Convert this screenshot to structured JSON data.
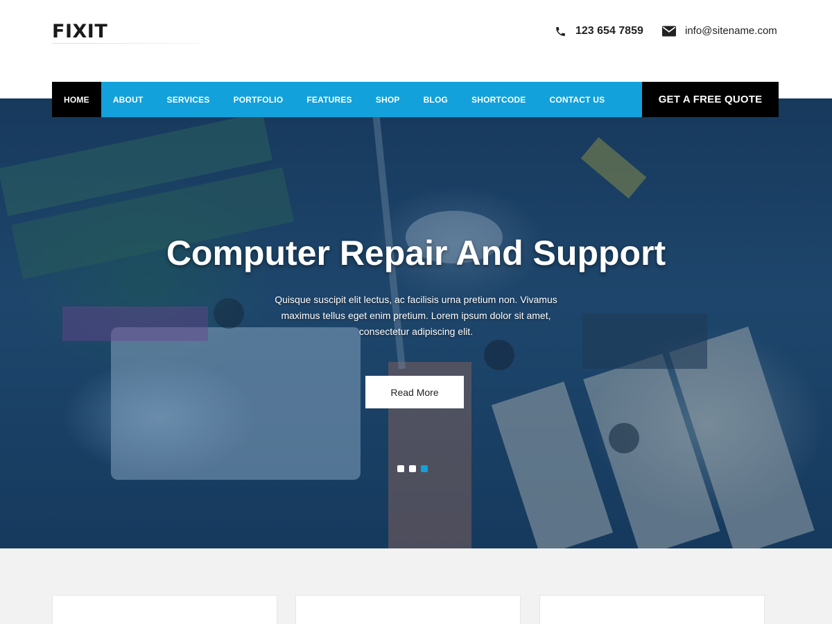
{
  "header": {
    "logo": "FIXIT",
    "phone": "123 654 7859",
    "email": "info@sitename.com",
    "phone_icon": "phone-icon",
    "email_icon": "envelope-icon"
  },
  "nav": {
    "items": [
      {
        "label": "HOME",
        "active": true
      },
      {
        "label": "ABOUT"
      },
      {
        "label": "SERVICES"
      },
      {
        "label": "PORTFOLIO"
      },
      {
        "label": "FEATURES"
      },
      {
        "label": "SHOP"
      },
      {
        "label": "BLOG"
      },
      {
        "label": "SHORTCODE"
      },
      {
        "label": "CONTACT US"
      }
    ],
    "cta": "GET A FREE QUOTE"
  },
  "hero": {
    "title": "Computer Repair And Support",
    "text": "Quisque suscipit elit lectus, ac facilisis urna pretium non. Vivamus maximus tellus eget enim pretium. Lorem ipsum dolor sit amet, consectetur adipiscing elit.",
    "button": "Read More",
    "slide_count": 3,
    "active_slide": 3
  },
  "colors": {
    "accent": "#12a1db",
    "dark": "#000000",
    "section_bg": "#f2f2f2"
  }
}
